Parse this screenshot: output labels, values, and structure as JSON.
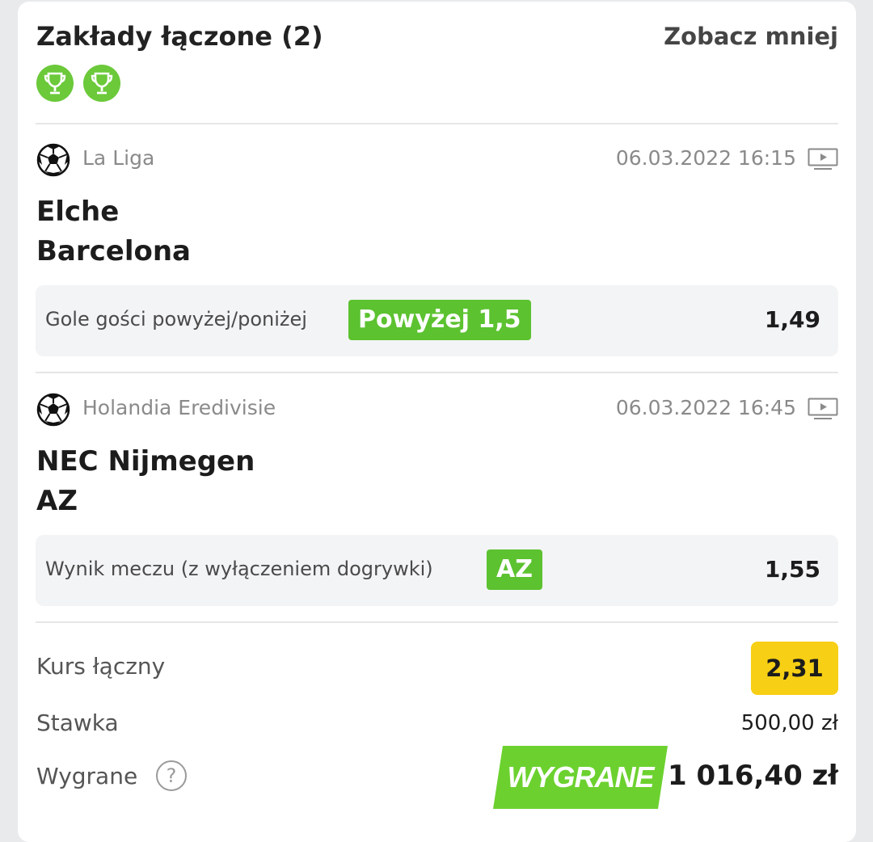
{
  "header": {
    "title": "Zakłady łączone (2)",
    "toggle_label": "Zobacz mniej",
    "trophy_icons": [
      "trophy-icon",
      "trophy-icon"
    ]
  },
  "bets": [
    {
      "league": "La Liga",
      "datetime": "06.03.2022 16:15",
      "home": "Elche",
      "away": "Barcelona",
      "market": "Gole gości powyżej/poniżej",
      "pick": "Powyżej 1,5",
      "odd": "1,49"
    },
    {
      "league": "Holandia Eredivisie",
      "datetime": "06.03.2022 16:45",
      "home": "NEC Nijmegen",
      "away": "AZ",
      "market": "Wynik meczu (z wyłączeniem dogrywki)",
      "pick": "AZ",
      "odd": "1,55"
    }
  ],
  "summary": {
    "total_odds_label": "Kurs łączny",
    "total_odds": "2,31",
    "stake_label": "Stawka",
    "stake": "500,00 zł",
    "winnings_label": "Wygrane",
    "won_badge": "WYGRANE",
    "winnings": "1 016,40 zł"
  },
  "colors": {
    "accent_green": "#5cc230",
    "odds_yellow": "#f7cf14",
    "won_green": "#6cd12f"
  }
}
